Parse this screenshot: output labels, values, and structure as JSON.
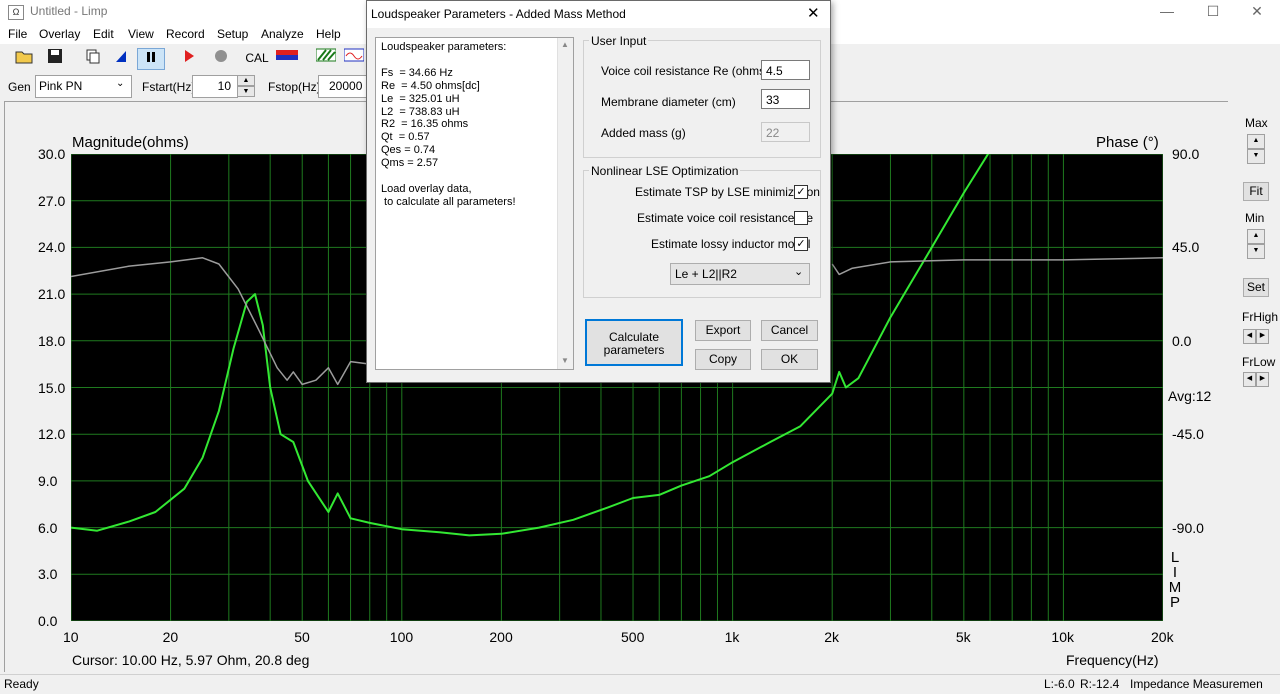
{
  "window": {
    "title": "Untitled - Limp",
    "app_icon": "speaker-app-icon"
  },
  "menu": [
    "File",
    "Overlay",
    "Edit",
    "View",
    "Record",
    "Setup",
    "Analyze",
    "Help"
  ],
  "toolbar": {
    "cal_label": "CAL"
  },
  "gen_row": {
    "gen_label": "Gen",
    "gen_value": "Pink PN",
    "fstart_label": "Fstart(Hz)",
    "fstart_value": "10",
    "fstop_label": "Fstop(Hz)",
    "fstop_value": "20000"
  },
  "graph": {
    "left_title": "Magnitude(ohms)",
    "right_title": "Phase (°)",
    "left_ticks": [
      "30.0",
      "27.0",
      "24.0",
      "21.0",
      "18.0",
      "15.0",
      "12.0",
      "9.0",
      "6.0",
      "3.0",
      "0.0"
    ],
    "right_ticks": [
      "90.0",
      "45.0",
      "0.0",
      "-45.0",
      "-90.0"
    ],
    "x_ticks": [
      "10",
      "20",
      "50",
      "100",
      "200",
      "500",
      "1k",
      "2k",
      "5k",
      "10k",
      "20k"
    ],
    "avg_label": "Avg:12",
    "cursor_text": "Cursor: 10.00 Hz, 5.97 Ohm, 20.8 deg",
    "x_axis_title": "Frequency(Hz)",
    "vertical_brand": [
      "L",
      "I",
      "M",
      "P"
    ],
    "colors": {
      "background": "#000000",
      "grid": "#1f7a1f",
      "magnitude": "#33e833",
      "phase": "#9c9c9c"
    }
  },
  "right_panel": {
    "max_label": "Max",
    "fit_label": "Fit",
    "min_label": "Min",
    "set_label": "Set",
    "frhigh_label": "FrHigh",
    "frlow_label": "FrLow"
  },
  "status": {
    "left": "Ready",
    "l_value": "L:-6.0",
    "r_value": "R:-12.4",
    "mode": "Impedance Measuremen"
  },
  "dialog": {
    "title": "Loudspeaker Parameters - Added Mass Method",
    "results_lines": [
      "Loudspeaker parameters:",
      "",
      "Fs  = 34.66 Hz",
      "Re  = 4.50 ohms[dc]",
      "Le  = 325.01 uH",
      "L2  = 738.83 uH",
      "R2  = 16.35 ohms",
      "Qt  = 0.57",
      "Qes = 0.74",
      "Qms = 2.57",
      "",
      "Load overlay data,",
      " to calculate all parameters!"
    ],
    "user_input_label": "User Input",
    "re_label": "Voice coil resistance Re (ohms)",
    "re_value": "4.5",
    "diam_label": "Membrane diameter (cm)",
    "diam_value": "33",
    "mass_label": "Added mass (g)",
    "mass_value": "22",
    "lse_label": "Nonlinear LSE Optimization",
    "chk1_label": "Estimate TSP by LSE minimization",
    "chk1": true,
    "chk2_label": "Estimate voice coil resistance Re",
    "chk2": false,
    "chk3_label": "Estimate lossy inductor model",
    "chk3": true,
    "model_value": "Le + L2||R2",
    "calc_line1": "Calculate",
    "calc_line2": "parameters",
    "export_label": "Export",
    "cancel_label": "Cancel",
    "copy_label": "Copy",
    "ok_label": "OK"
  },
  "chart_data": {
    "type": "line",
    "xscale": "log",
    "xlim": [
      10,
      20000
    ],
    "ylim": [
      0,
      30
    ],
    "y2lim": [
      -135,
      90
    ],
    "xlabel": "Frequency(Hz)",
    "ylabel": "Magnitude(ohms)",
    "y2label": "Phase (°)",
    "series": [
      {
        "axis": "left",
        "color": "#33e833",
        "x": [
          10,
          12,
          15,
          18,
          22,
          25,
          28,
          31,
          34,
          36,
          38,
          40,
          43,
          47,
          52,
          60,
          64,
          70,
          80,
          100,
          130,
          160,
          200,
          260,
          330,
          420,
          500,
          600,
          700,
          850,
          1000,
          1300,
          1600,
          2000,
          2100,
          2200,
          2400,
          3000,
          4000,
          5000,
          6000,
          7000,
          8000
        ],
        "y": [
          6.0,
          5.8,
          6.4,
          7.0,
          8.5,
          10.5,
          13.5,
          17.5,
          20.5,
          21.0,
          19.0,
          15.0,
          12.0,
          11.5,
          9.0,
          7.0,
          8.2,
          6.6,
          6.3,
          5.9,
          5.7,
          5.5,
          5.6,
          6.0,
          6.5,
          7.3,
          7.9,
          8.1,
          8.7,
          9.3,
          10.2,
          11.5,
          12.5,
          14.6,
          16.0,
          15.0,
          15.6,
          19.5,
          24.0,
          27.5,
          30.2,
          31.5,
          33.0
        ]
      },
      {
        "axis": "right",
        "color": "#9c9c9c",
        "x": [
          10,
          15,
          20,
          25,
          28,
          32,
          37,
          42,
          45,
          47,
          50,
          55,
          60,
          64,
          70,
          78,
          90
        ],
        "y": [
          31,
          36,
          38,
          40,
          37,
          25,
          5,
          -13,
          -19,
          -15,
          -21,
          -19,
          -13,
          -21,
          -10,
          -11,
          -7
        ]
      },
      {
        "axis": "right",
        "color": "#9c9c9c",
        "x": [
          2000,
          2100,
          2300,
          3000,
          5000,
          10000,
          20000
        ],
        "y": [
          37,
          32,
          35,
          38,
          39,
          39,
          40
        ]
      }
    ]
  }
}
